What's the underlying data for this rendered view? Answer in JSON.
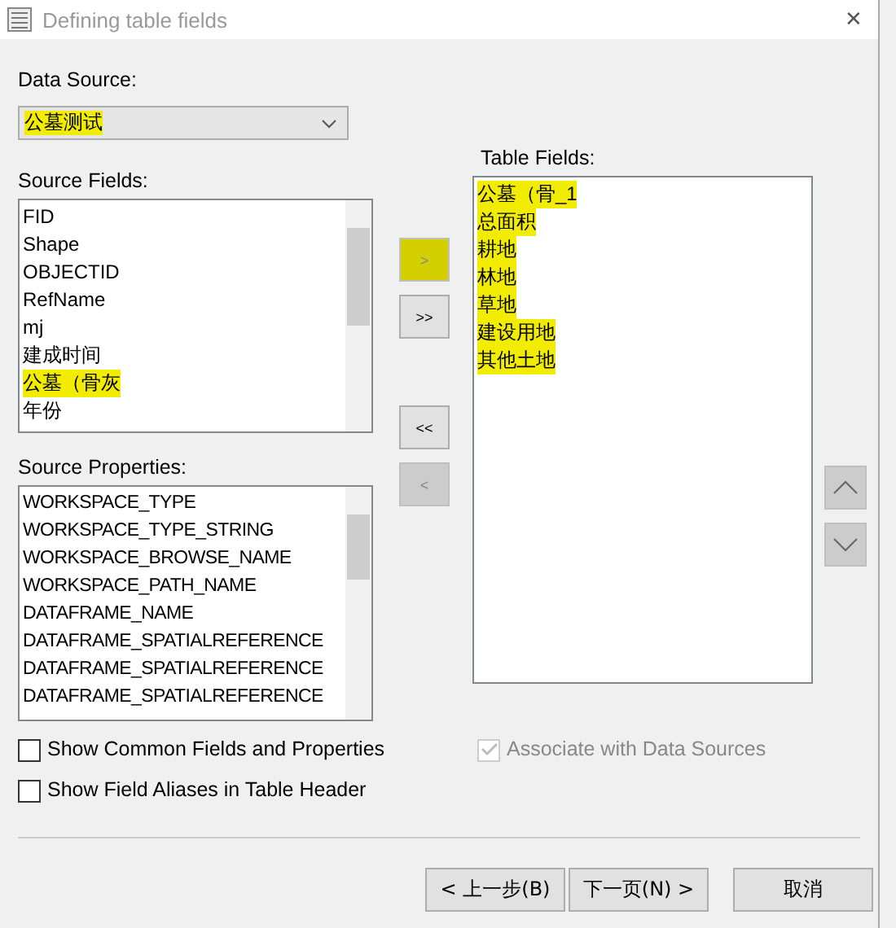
{
  "window": {
    "title": "Defining table fields",
    "close": "✕"
  },
  "data_source": {
    "label": "Data Source:",
    "value": "公墓测试",
    "highlighted": true
  },
  "source_fields": {
    "label": "Source Fields:",
    "items": [
      {
        "text": "FID",
        "highlighted": false
      },
      {
        "text": "Shape",
        "highlighted": false
      },
      {
        "text": "OBJECTID",
        "highlighted": false
      },
      {
        "text": "RefName",
        "highlighted": false
      },
      {
        "text": "mj",
        "highlighted": false
      },
      {
        "text": "建成时间",
        "highlighted": false
      },
      {
        "text": "公墓（骨灰",
        "highlighted": true
      },
      {
        "text": "年份",
        "highlighted": false
      }
    ]
  },
  "source_properties": {
    "label": "Source Properties:",
    "items": [
      {
        "text": "WORKSPACE_TYPE",
        "highlighted": false
      },
      {
        "text": "WORKSPACE_TYPE_STRING",
        "highlighted": false
      },
      {
        "text": "WORKSPACE_BROWSE_NAME",
        "highlighted": false
      },
      {
        "text": "WORKSPACE_PATH_NAME",
        "highlighted": false
      },
      {
        "text": "DATAFRAME_NAME",
        "highlighted": false
      },
      {
        "text": "DATAFRAME_SPATIALREFERENCE",
        "highlighted": false
      },
      {
        "text": "DATAFRAME_SPATIALREFERENCE",
        "highlighted": false
      },
      {
        "text": "DATAFRAME_SPATIALREFERENCE",
        "highlighted": false
      }
    ]
  },
  "add_buttons": [
    {
      "label": ">",
      "disabled": true,
      "highlighted": true
    },
    {
      "label": ">>",
      "disabled": false,
      "highlighted": false
    }
  ],
  "remove_buttons": [
    {
      "label": "<<",
      "disabled": false,
      "highlighted": false
    },
    {
      "label": "<",
      "disabled": true,
      "highlighted": false
    }
  ],
  "table_fields": {
    "label": "Table Fields:",
    "items": [
      {
        "text": "公墓（骨_1",
        "highlighted": true
      },
      {
        "text": "总面积",
        "highlighted": true
      },
      {
        "text": "耕地",
        "highlighted": true
      },
      {
        "text": "林地",
        "highlighted": true
      },
      {
        "text": "草地",
        "highlighted": true
      },
      {
        "text": "建设用地",
        "highlighted": true
      },
      {
        "text": "其他土地",
        "highlighted": true
      }
    ]
  },
  "options": [
    {
      "label": "Show Common Fields and Properties",
      "checked": false,
      "disabled": false
    },
    {
      "label": "Show Field Aliases in Table Header",
      "checked": false,
      "disabled": false
    }
  ],
  "associate": {
    "label": "Associate with Data Sources",
    "checked": true,
    "disabled": true
  },
  "footer_buttons": [
    "< 上一步(B)",
    "下一页(N) >",
    "取消"
  ]
}
